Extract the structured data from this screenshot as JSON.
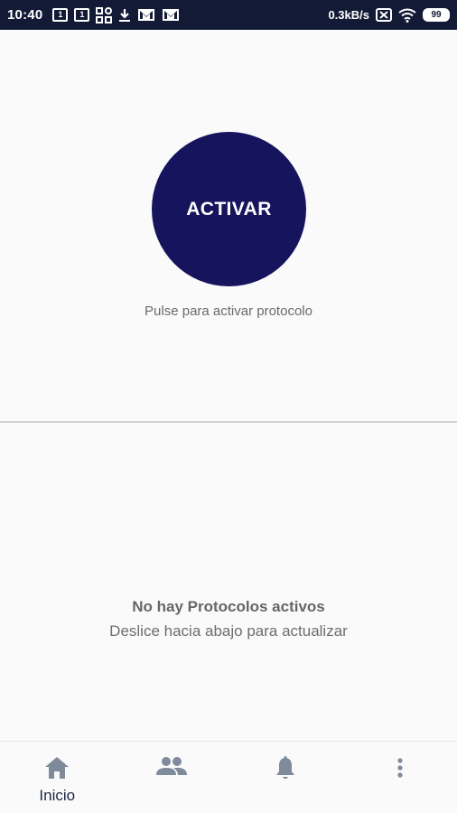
{
  "status_bar": {
    "time": "10:40",
    "sim1": "1",
    "sim2": "1",
    "speed": "0.3kB/s",
    "battery": "99"
  },
  "activate": {
    "button_label": "ACTIVAR",
    "hint": "Pulse para activar protocolo",
    "color": "#15145c"
  },
  "protocols": {
    "empty_title": "No hay Protocolos activos",
    "empty_subtitle": "Deslice hacia abajo para actualizar"
  },
  "bottom_nav": {
    "items": [
      {
        "icon": "home-icon",
        "label": "Inicio",
        "active": true
      },
      {
        "icon": "people-icon",
        "label": ""
      },
      {
        "icon": "bell-icon",
        "label": ""
      },
      {
        "icon": "more-vertical-icon",
        "label": ""
      }
    ]
  },
  "colors": {
    "status_bar": "#131a36",
    "nav_icon": "#7f8a9a"
  }
}
